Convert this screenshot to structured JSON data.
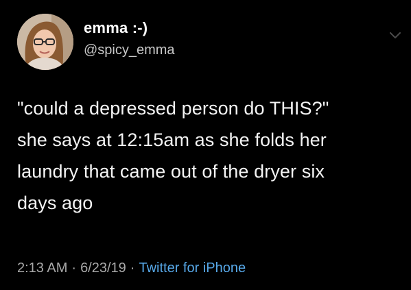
{
  "tweet": {
    "display_name": "emma :-)",
    "handle": "@spicy_emma",
    "text": "\"could a depressed person do THIS?\"\nshe says at 12:15am as she folds her\nlaundry that came out of the dryer six\ndays ago",
    "time": "2:13 AM",
    "date": "6/23/19",
    "separator": "·",
    "source": "Twitter for iPhone",
    "menu_icon": "chevron-down-icon",
    "avatar_icon": "profile-photo"
  },
  "colors": {
    "background": "#000000",
    "text": "#f4f4f4",
    "meta": "#a9a9a9",
    "link": "#57a8e8"
  }
}
